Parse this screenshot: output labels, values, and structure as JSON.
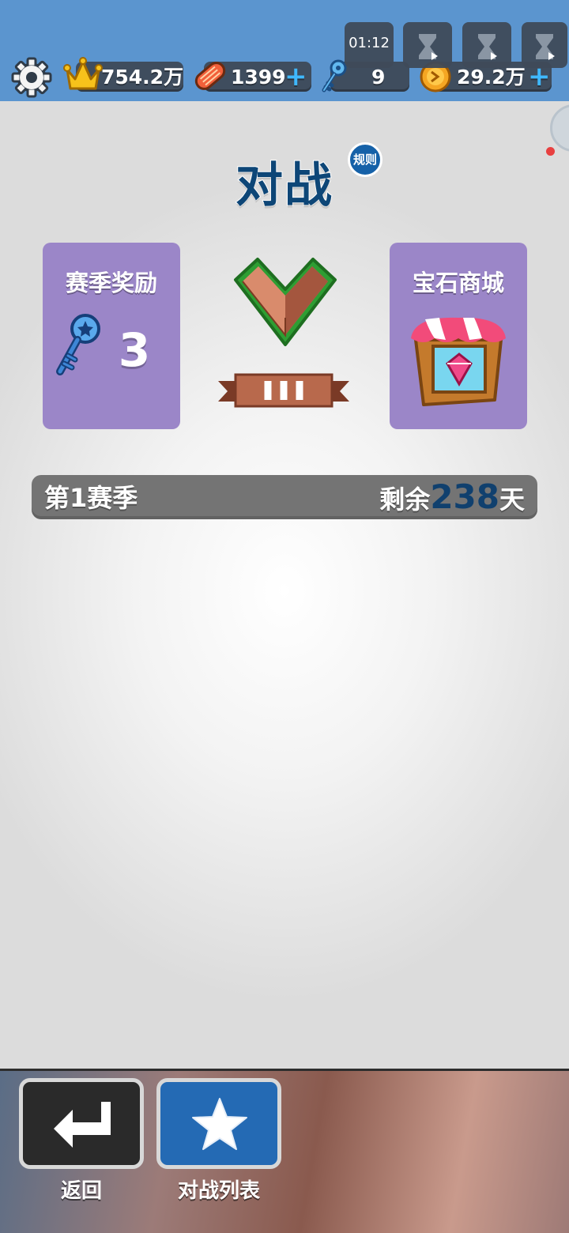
{
  "topbar": {
    "crowns": "754.2万",
    "tickets": "1399",
    "keys": "9",
    "coins": "29.2万",
    "timer": "01:12",
    "plus_sign": "+"
  },
  "page": {
    "title": "对战",
    "rules_label": "规则"
  },
  "season_reward": {
    "title": "赛季奖励",
    "key_count": "3"
  },
  "rank": {
    "tier_icon": "bronze-chevron-icon",
    "tier_level": 3
  },
  "gem_shop": {
    "title": "宝石商城",
    "icon": "gem-shop-stall-icon"
  },
  "season": {
    "name": "第1赛季",
    "remaining_prefix": "剩余",
    "remaining_days": "238",
    "remaining_suffix": "天"
  },
  "buttons": {
    "back_label": "返回",
    "list_label": "对战列表"
  },
  "colors": {
    "topbar": "#5b95cf",
    "card": "#9b86c8",
    "title": "#0d4677",
    "days_highlight": "#10406e",
    "list_button": "#246ab4"
  }
}
